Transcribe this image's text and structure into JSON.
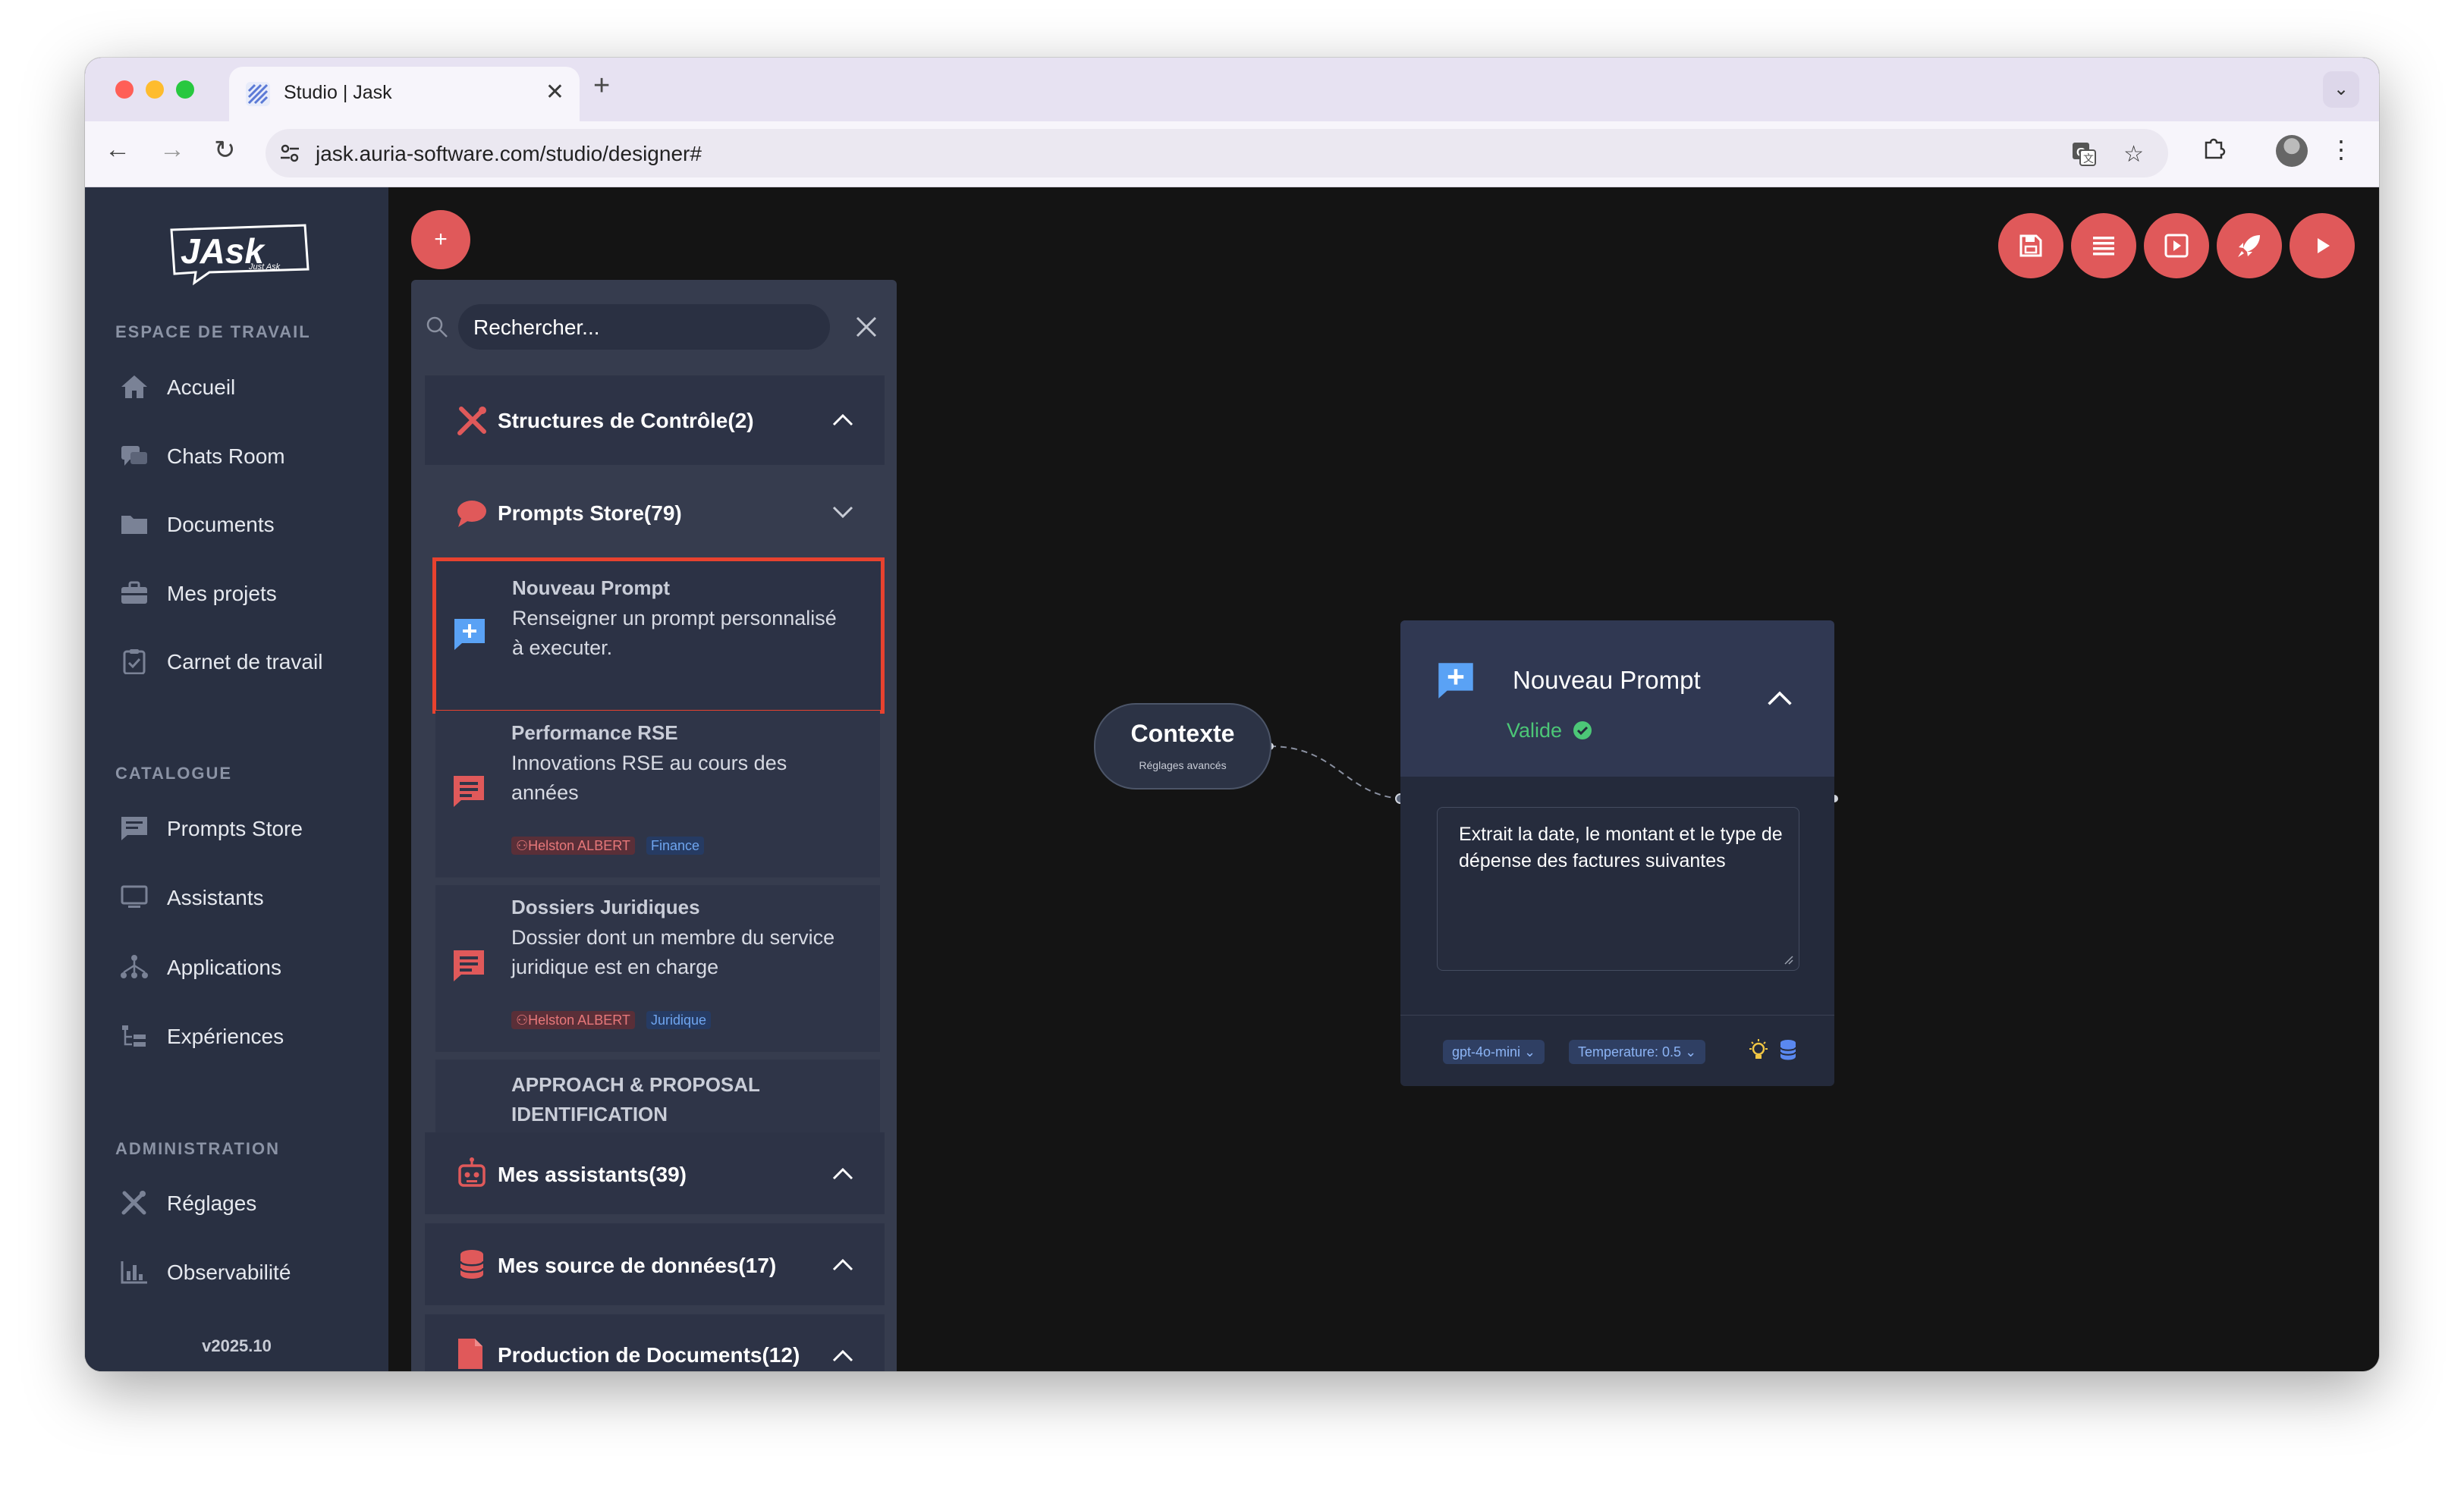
{
  "browser": {
    "tab_title": "Studio | Jask",
    "url": "jask.auria-software.com/studio/designer#"
  },
  "sidebar": {
    "logo_text": "JAsk",
    "logo_tagline": "Just Ask",
    "sections": {
      "workspace": "ESPACE DE TRAVAIL",
      "catalogue": "CATALOGUE",
      "administration": "ADMINISTRATION"
    },
    "workspace_items": [
      {
        "label": "Accueil",
        "icon": "home-icon"
      },
      {
        "label": "Chats Room",
        "icon": "chat-bubbles-icon"
      },
      {
        "label": "Documents",
        "icon": "folder-icon"
      },
      {
        "label": "Mes projets",
        "icon": "briefcase-icon"
      },
      {
        "label": "Carnet de travail",
        "icon": "clipboard-check-icon"
      }
    ],
    "catalogue_items": [
      {
        "label": "Prompts Store",
        "icon": "message-square-icon"
      },
      {
        "label": "Assistants",
        "icon": "monitor-icon"
      },
      {
        "label": "Applications",
        "icon": "sitemap-icon"
      },
      {
        "label": "Expériences",
        "icon": "tree-list-icon"
      }
    ],
    "admin_items": [
      {
        "label": "Réglages",
        "icon": "tools-icon"
      },
      {
        "label": "Observabilité",
        "icon": "bar-chart-icon"
      }
    ],
    "version": "v2025.10"
  },
  "canvas": {
    "add_button": "+"
  },
  "library": {
    "search_placeholder": "Rechercher...",
    "sections": [
      {
        "label": "Structures de Contrôle(2)",
        "icon": "tools-icon",
        "state": "expanded"
      },
      {
        "label": "Prompts Store(79)",
        "icon": "speech-bubble-icon",
        "state": "collapsed"
      },
      {
        "label": "Mes assistants(39)",
        "icon": "robot-icon",
        "state": "expanded"
      },
      {
        "label": "Mes source de données(17)",
        "icon": "database-icon",
        "state": "expanded"
      },
      {
        "label": "Production de Documents(12)",
        "icon": "document-icon",
        "state": "expanded"
      }
    ],
    "cards": [
      {
        "title": "Nouveau Prompt",
        "desc_lines": [
          "Renseigner un prompt personnalisé",
          "à executer."
        ],
        "highlighted": true
      },
      {
        "title": "Performance RSE",
        "desc_lines": [
          "Innovations RSE au cours des",
          "années"
        ],
        "author": "Helston ALBERT",
        "category": "Finance"
      },
      {
        "title": "Dossiers Juridiques",
        "desc_lines": [
          "Dossier dont un membre du service",
          "juridique est en charge"
        ],
        "author": "Helston ALBERT",
        "category": "Juridique"
      },
      {
        "title_lines": [
          "APPROACH & PROPOSAL",
          "IDENTIFICATION"
        ]
      }
    ]
  },
  "flow": {
    "context_node": {
      "title": "Contexte",
      "subtitle": "Réglages avancés"
    },
    "prompt_node": {
      "title": "Nouveau Prompt",
      "status": "Valide",
      "prompt_text": "Extrait la date, le montant et le type de dépense des factures suivantes",
      "model": "gpt-4o-mini",
      "temperature": "Temperature: 0.5"
    }
  },
  "colors": {
    "accent": "#e0595a",
    "sidebar_bg": "#293042",
    "panel_bg": "#363c4e",
    "canvas_bg": "#141414",
    "valid_green": "#4cc777",
    "highlight_border": "#e8422f"
  }
}
